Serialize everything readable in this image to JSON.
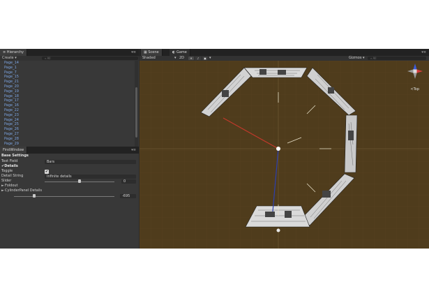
{
  "hierarchy": {
    "tab_label": "Hierarchy",
    "create_label": "Create",
    "search_placeholder": "All",
    "items": [
      "Page_14",
      "Page_1",
      "Page_7",
      "Page_15",
      "Page_21",
      "Page_20",
      "Page_19",
      "Page_18",
      "Page_17",
      "Page_16",
      "Page_22",
      "Page_23",
      "Page_24",
      "Page_25",
      "Page_26",
      "Page_27",
      "Page_28",
      "Page_29"
    ]
  },
  "first_window": {
    "tab_label": "FirstWindow",
    "base_settings": "Base Settings",
    "text_field_label": "Text Field",
    "text_field_value": "Bars",
    "details_label": "Details",
    "toggle_label": "Toggle",
    "toggle_checked": true,
    "detail_string_label": "Detail String",
    "detail_string_value": "Infinite details",
    "slider_label": "Slider",
    "slider_value": "0",
    "slider_fraction": 0.5,
    "foldout_label": "Foldout",
    "cylinder_label": "CylinderPanel Details",
    "second_slider_value": "-695",
    "second_slider_fraction": 0.2
  },
  "scene": {
    "scene_tab": "Scene",
    "game_tab": "Game",
    "shading_mode": "Shaded",
    "mode_2d": "2D",
    "gizmos_label": "Gizmos",
    "search_placeholder": "All",
    "perspective_label": "Top",
    "colors": {
      "background": "#4f3c1c",
      "axis_x": "#c0392b",
      "axis_y": "#2c3fb0"
    }
  }
}
